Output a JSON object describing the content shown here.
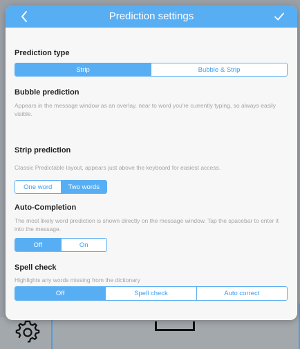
{
  "header": {
    "title": "Prediction settings",
    "back_icon": "chevron-left-icon",
    "done_icon": "checkmark-icon"
  },
  "colors": {
    "accent": "#58aef3",
    "text_dark": "#222222",
    "text_muted": "#a4a4a4",
    "modal_bg": "#f7f7f7"
  },
  "prediction_type": {
    "heading": "Prediction type",
    "options": [
      "Strip",
      "Bubble & Strip"
    ],
    "selected": "Strip"
  },
  "bubble_prediction": {
    "heading": "Bubble prediction",
    "description": "Appears in the message window as an overlay, near to word you're currently typing, so always easily visible."
  },
  "strip_prediction": {
    "heading": "Strip prediction",
    "description": "Classic Predictable layout, appears just above the keyboard for easiest access.",
    "options": [
      "One word",
      "Two words"
    ],
    "selected": "Two words"
  },
  "auto_completion": {
    "heading": "Auto-Completion",
    "description": "The most likely word prediction is shown directly on the message window. Tap the spacebar to enter it into the message.",
    "options": [
      "Off",
      "On"
    ],
    "selected": "Off"
  },
  "spell_check": {
    "heading": "Spell check",
    "description": "Highlights any words missing from the dictionary",
    "options": [
      "Off",
      "Spell check",
      "Auto correct"
    ],
    "selected": "Off"
  },
  "background": {
    "settings_icon": "gear-icon"
  }
}
